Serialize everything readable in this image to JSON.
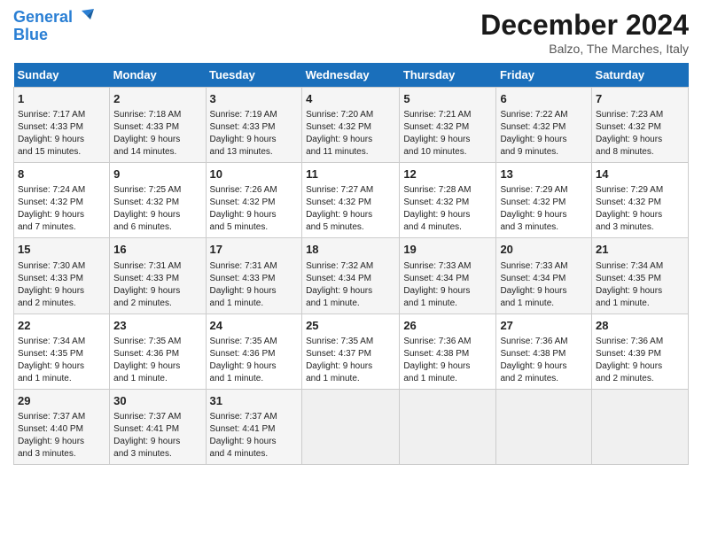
{
  "header": {
    "logo_line1": "General",
    "logo_line2": "Blue",
    "month": "December 2024",
    "location": "Balzo, The Marches, Italy"
  },
  "weekdays": [
    "Sunday",
    "Monday",
    "Tuesday",
    "Wednesday",
    "Thursday",
    "Friday",
    "Saturday"
  ],
  "weeks": [
    [
      {
        "day": "1",
        "lines": [
          "Sunrise: 7:17 AM",
          "Sunset: 4:33 PM",
          "Daylight: 9 hours",
          "and 15 minutes."
        ]
      },
      {
        "day": "2",
        "lines": [
          "Sunrise: 7:18 AM",
          "Sunset: 4:33 PM",
          "Daylight: 9 hours",
          "and 14 minutes."
        ]
      },
      {
        "day": "3",
        "lines": [
          "Sunrise: 7:19 AM",
          "Sunset: 4:33 PM",
          "Daylight: 9 hours",
          "and 13 minutes."
        ]
      },
      {
        "day": "4",
        "lines": [
          "Sunrise: 7:20 AM",
          "Sunset: 4:32 PM",
          "Daylight: 9 hours",
          "and 11 minutes."
        ]
      },
      {
        "day": "5",
        "lines": [
          "Sunrise: 7:21 AM",
          "Sunset: 4:32 PM",
          "Daylight: 9 hours",
          "and 10 minutes."
        ]
      },
      {
        "day": "6",
        "lines": [
          "Sunrise: 7:22 AM",
          "Sunset: 4:32 PM",
          "Daylight: 9 hours",
          "and 9 minutes."
        ]
      },
      {
        "day": "7",
        "lines": [
          "Sunrise: 7:23 AM",
          "Sunset: 4:32 PM",
          "Daylight: 9 hours",
          "and 8 minutes."
        ]
      }
    ],
    [
      {
        "day": "8",
        "lines": [
          "Sunrise: 7:24 AM",
          "Sunset: 4:32 PM",
          "Daylight: 9 hours",
          "and 7 minutes."
        ]
      },
      {
        "day": "9",
        "lines": [
          "Sunrise: 7:25 AM",
          "Sunset: 4:32 PM",
          "Daylight: 9 hours",
          "and 6 minutes."
        ]
      },
      {
        "day": "10",
        "lines": [
          "Sunrise: 7:26 AM",
          "Sunset: 4:32 PM",
          "Daylight: 9 hours",
          "and 5 minutes."
        ]
      },
      {
        "day": "11",
        "lines": [
          "Sunrise: 7:27 AM",
          "Sunset: 4:32 PM",
          "Daylight: 9 hours",
          "and 5 minutes."
        ]
      },
      {
        "day": "12",
        "lines": [
          "Sunrise: 7:28 AM",
          "Sunset: 4:32 PM",
          "Daylight: 9 hours",
          "and 4 minutes."
        ]
      },
      {
        "day": "13",
        "lines": [
          "Sunrise: 7:29 AM",
          "Sunset: 4:32 PM",
          "Daylight: 9 hours",
          "and 3 minutes."
        ]
      },
      {
        "day": "14",
        "lines": [
          "Sunrise: 7:29 AM",
          "Sunset: 4:32 PM",
          "Daylight: 9 hours",
          "and 3 minutes."
        ]
      }
    ],
    [
      {
        "day": "15",
        "lines": [
          "Sunrise: 7:30 AM",
          "Sunset: 4:33 PM",
          "Daylight: 9 hours",
          "and 2 minutes."
        ]
      },
      {
        "day": "16",
        "lines": [
          "Sunrise: 7:31 AM",
          "Sunset: 4:33 PM",
          "Daylight: 9 hours",
          "and 2 minutes."
        ]
      },
      {
        "day": "17",
        "lines": [
          "Sunrise: 7:31 AM",
          "Sunset: 4:33 PM",
          "Daylight: 9 hours",
          "and 1 minute."
        ]
      },
      {
        "day": "18",
        "lines": [
          "Sunrise: 7:32 AM",
          "Sunset: 4:34 PM",
          "Daylight: 9 hours",
          "and 1 minute."
        ]
      },
      {
        "day": "19",
        "lines": [
          "Sunrise: 7:33 AM",
          "Sunset: 4:34 PM",
          "Daylight: 9 hours",
          "and 1 minute."
        ]
      },
      {
        "day": "20",
        "lines": [
          "Sunrise: 7:33 AM",
          "Sunset: 4:34 PM",
          "Daylight: 9 hours",
          "and 1 minute."
        ]
      },
      {
        "day": "21",
        "lines": [
          "Sunrise: 7:34 AM",
          "Sunset: 4:35 PM",
          "Daylight: 9 hours",
          "and 1 minute."
        ]
      }
    ],
    [
      {
        "day": "22",
        "lines": [
          "Sunrise: 7:34 AM",
          "Sunset: 4:35 PM",
          "Daylight: 9 hours",
          "and 1 minute."
        ]
      },
      {
        "day": "23",
        "lines": [
          "Sunrise: 7:35 AM",
          "Sunset: 4:36 PM",
          "Daylight: 9 hours",
          "and 1 minute."
        ]
      },
      {
        "day": "24",
        "lines": [
          "Sunrise: 7:35 AM",
          "Sunset: 4:36 PM",
          "Daylight: 9 hours",
          "and 1 minute."
        ]
      },
      {
        "day": "25",
        "lines": [
          "Sunrise: 7:35 AM",
          "Sunset: 4:37 PM",
          "Daylight: 9 hours",
          "and 1 minute."
        ]
      },
      {
        "day": "26",
        "lines": [
          "Sunrise: 7:36 AM",
          "Sunset: 4:38 PM",
          "Daylight: 9 hours",
          "and 1 minute."
        ]
      },
      {
        "day": "27",
        "lines": [
          "Sunrise: 7:36 AM",
          "Sunset: 4:38 PM",
          "Daylight: 9 hours",
          "and 2 minutes."
        ]
      },
      {
        "day": "28",
        "lines": [
          "Sunrise: 7:36 AM",
          "Sunset: 4:39 PM",
          "Daylight: 9 hours",
          "and 2 minutes."
        ]
      }
    ],
    [
      {
        "day": "29",
        "lines": [
          "Sunrise: 7:37 AM",
          "Sunset: 4:40 PM",
          "Daylight: 9 hours",
          "and 3 minutes."
        ]
      },
      {
        "day": "30",
        "lines": [
          "Sunrise: 7:37 AM",
          "Sunset: 4:41 PM",
          "Daylight: 9 hours",
          "and 3 minutes."
        ]
      },
      {
        "day": "31",
        "lines": [
          "Sunrise: 7:37 AM",
          "Sunset: 4:41 PM",
          "Daylight: 9 hours",
          "and 4 minutes."
        ]
      },
      null,
      null,
      null,
      null
    ]
  ]
}
